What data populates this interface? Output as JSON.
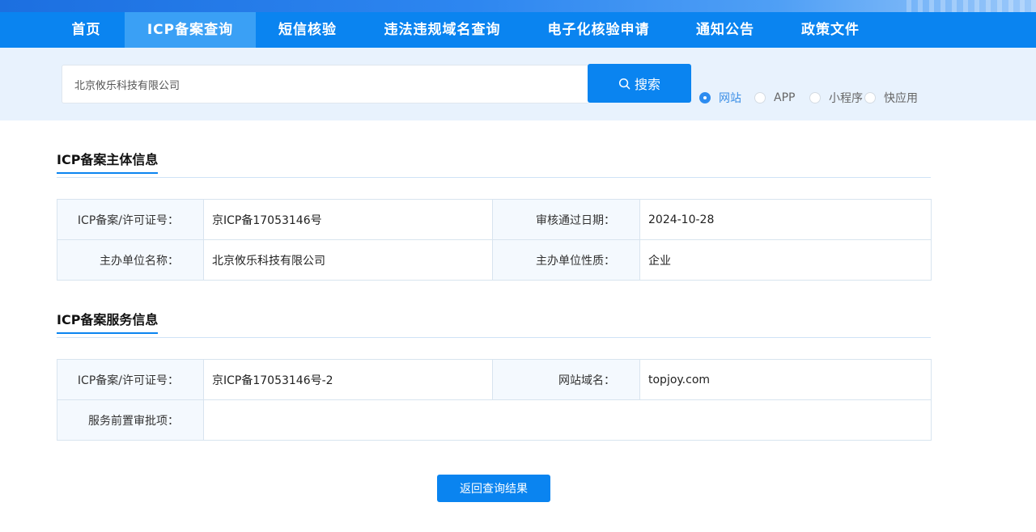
{
  "nav": {
    "items": [
      {
        "label": "首页"
      },
      {
        "label": "ICP备案查询"
      },
      {
        "label": "短信核验"
      },
      {
        "label": "违法违规域名查询"
      },
      {
        "label": "电子化核验申请"
      },
      {
        "label": "通知公告"
      },
      {
        "label": "政策文件"
      }
    ],
    "active_index": 1
  },
  "search": {
    "value": "北京攸乐科技有限公司",
    "button_label": "搜索",
    "types": [
      {
        "label": "网站",
        "checked": true
      },
      {
        "label": "APP",
        "checked": false
      },
      {
        "label": "小程序",
        "checked": false
      },
      {
        "label": "快应用",
        "checked": false
      }
    ]
  },
  "subject_section": {
    "title": "ICP备案主体信息",
    "rows": [
      [
        {
          "label": "ICP备案/许可证号：",
          "value": "京ICP备17053146号"
        },
        {
          "label": "审核通过日期：",
          "value": "2024-10-28"
        }
      ],
      [
        {
          "label": "主办单位名称：",
          "value": "北京攸乐科技有限公司"
        },
        {
          "label": "主办单位性质：",
          "value": "企业"
        }
      ]
    ]
  },
  "service_section": {
    "title": "ICP备案服务信息",
    "rows": [
      [
        {
          "label": "ICP备案/许可证号：",
          "value": "京ICP备17053146号-2"
        },
        {
          "label": "网站域名：",
          "value": "topjoy.com"
        }
      ],
      [
        {
          "label": "服务前置审批项：",
          "value": ""
        }
      ]
    ]
  },
  "return_button_label": "返回查询结果",
  "colors": {
    "nav_bg": "#0a84f0",
    "nav_active_bg": "#3aa0f5",
    "search_band_bg": "#e8f2fd",
    "label_cell_bg": "#f4f9fe",
    "accent": "#0a84f0"
  }
}
